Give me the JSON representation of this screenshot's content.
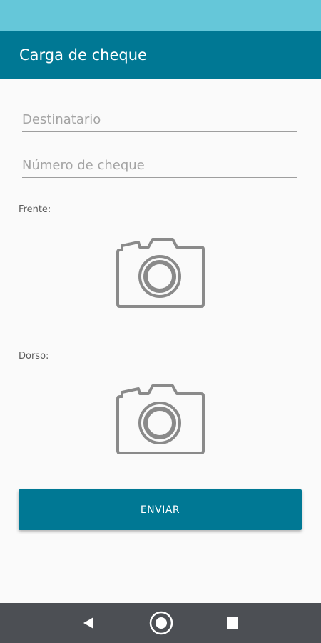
{
  "app_bar": {
    "title": "Carga de cheque"
  },
  "form": {
    "destinatario_placeholder": "Destinatario",
    "numero_placeholder": "Número de cheque",
    "front_label": "Frente:",
    "back_label": "Dorso:",
    "submit_label": "ENVIAR"
  },
  "icons": {
    "front_photo": "camera-icon",
    "back_photo": "camera-icon",
    "nav_back": "back-triangle-icon",
    "nav_home": "home-circle-icon",
    "nav_recents": "recents-square-icon"
  },
  "colors": {
    "status_bar": "#65c7d9",
    "app_bar": "#007894",
    "button": "#007894",
    "nav_bar": "#4c4f54",
    "background": "#fafafa"
  }
}
